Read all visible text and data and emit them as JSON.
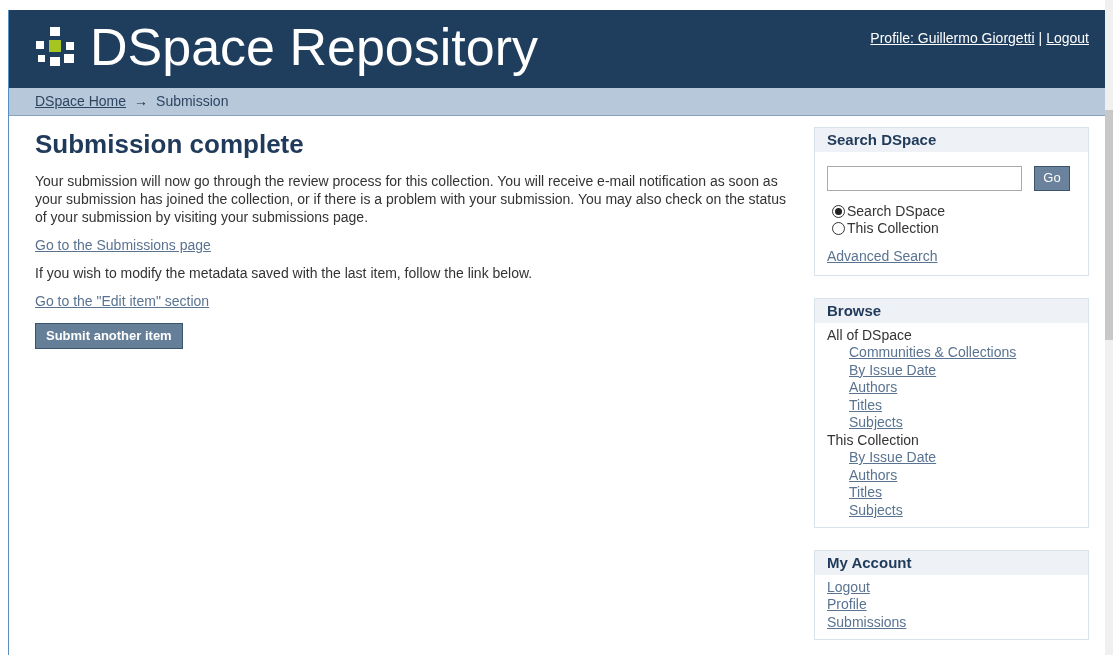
{
  "header": {
    "title": "DSpace Repository",
    "user_links": [
      {
        "label": "Profile: Guillermo Giorgetti"
      },
      {
        "label": "Logout"
      }
    ],
    "separator": "|"
  },
  "breadcrumb": {
    "items": [
      {
        "label": "DSpace Home",
        "kind": "link"
      },
      {
        "label": "Submission",
        "kind": "current"
      }
    ],
    "separator": "→"
  },
  "main": {
    "heading": "Submission complete",
    "blocks": [
      {
        "kind": "text",
        "text": "Your submission will now go through the review process for this collection. You will receive e-mail notification as soon as your submission has joined the collection, or if there is a problem with your submission. You may also check on the status of your submission by visiting your submissions page."
      },
      {
        "kind": "link",
        "text": "Go to the Submissions page"
      },
      {
        "kind": "text",
        "text": "If you wish to modify the metadata saved with the last item, follow the link below."
      },
      {
        "kind": "link",
        "text": "Go to the \"Edit item\" section"
      },
      {
        "kind": "button",
        "text": "Submit another item"
      }
    ]
  },
  "sidebar": {
    "search": {
      "title": "Search DSpace",
      "button": "Go",
      "scopes": [
        {
          "label": "Search DSpace",
          "selected": true
        },
        {
          "label": "This Collection",
          "selected": false
        }
      ],
      "advanced_link": "Advanced Search"
    },
    "browse": {
      "title": "Browse",
      "groups": [
        {
          "label": "All of DSpace",
          "children": [
            {
              "label": "Communities & Collections"
            },
            {
              "label": "By Issue Date"
            },
            {
              "label": "Authors"
            },
            {
              "label": "Titles"
            },
            {
              "label": "Subjects"
            }
          ]
        },
        {
          "label": "This Collection",
          "children": [
            {
              "label": "By Issue Date"
            },
            {
              "label": "Authors"
            },
            {
              "label": "Titles"
            },
            {
              "label": "Subjects"
            }
          ]
        }
      ]
    },
    "account": {
      "title": "My Account",
      "links": [
        {
          "label": "Logout"
        },
        {
          "label": "Profile"
        },
        {
          "label": "Submissions"
        }
      ]
    }
  }
}
